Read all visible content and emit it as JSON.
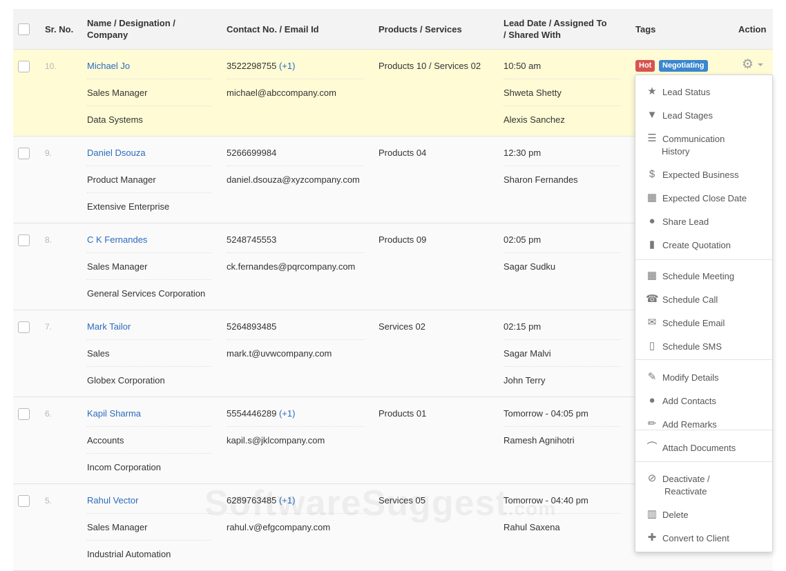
{
  "columns": {
    "srno": "Sr. No.",
    "name": [
      "Name / Designation /",
      "Company"
    ],
    "contact": "Contact No. / Email Id",
    "products": "Products / Services",
    "lead": [
      "Lead Date / Assigned To",
      "/ Shared With"
    ],
    "tags": "Tags",
    "action": "Action"
  },
  "leads": [
    {
      "sr": "10.",
      "name": "Michael Jo",
      "designation": "Sales Manager",
      "company": "Data Systems",
      "phone": "3522298755",
      "phone_ext": "(+1)",
      "email": "michael@abccompany.com",
      "products": "Products 10 / Services 02",
      "lead_date": "10:50 am",
      "assigned": "Shweta Shetty",
      "shared": "Alexis Sanchez"
    },
    {
      "sr": "9.",
      "name": "Daniel Dsouza",
      "designation": "Product Manager",
      "company": "Extensive Enterprise",
      "phone": "5266699984",
      "phone_ext": "",
      "email": "daniel.dsouza@xyzcompany.com",
      "products": "Products 04",
      "lead_date": "12:30 pm",
      "assigned": "Sharon Fernandes",
      "shared": ""
    },
    {
      "sr": "8.",
      "name": "C K Fernandes",
      "designation": "Sales Manager",
      "company": "General Services Corporation",
      "phone": "5248745553",
      "phone_ext": "",
      "email": "ck.fernandes@pqrcompany.com",
      "products": "Products 09",
      "lead_date": "02:05 pm",
      "assigned": "Sagar Sudku",
      "shared": ""
    },
    {
      "sr": "7.",
      "name": "Mark Tailor",
      "designation": "Sales",
      "company": "Globex Corporation",
      "phone": "5264893485",
      "phone_ext": "",
      "email": "mark.t@uvwcompany.com",
      "products": "Services 02",
      "lead_date": "02:15 pm",
      "assigned": "Sagar Malvi",
      "shared": "John Terry"
    },
    {
      "sr": "6.",
      "name": "Kapil Sharma",
      "designation": "Accounts",
      "company": "Incom Corporation",
      "phone": "5554446289",
      "phone_ext": "(+1)",
      "email": "kapil.s@jklcompany.com",
      "products": "Products 01",
      "lead_date": "Tomorrow - 04:05 pm",
      "assigned": "Ramesh Agnihotri",
      "shared": ""
    },
    {
      "sr": "5.",
      "name": "Rahul Vector",
      "designation": "Sales Manager",
      "company": "Industrial Automation",
      "phone": "6289763485",
      "phone_ext": "(+1)",
      "email": "rahul.v@efgcompany.com",
      "products": "Services 05",
      "lead_date": "Tomorrow - 04:40 pm",
      "assigned": "Rahul Saxena",
      "shared": ""
    }
  ],
  "tags": {
    "hot": "Hot",
    "negotiating": "Negotiating"
  },
  "tag_colors": {
    "hot": "#d9534f",
    "negotiating": "#3a87ce"
  },
  "highlight_color": "#fefbd5",
  "link_color": "#2a6bbf",
  "action_icon": "gear-icon",
  "menu": [
    {
      "icon": "star-icon",
      "label": "Lead Status"
    },
    {
      "icon": "filter-icon",
      "label": "Lead Stages"
    },
    {
      "icon": "list-icon",
      "label": "Communication",
      "label2": "History"
    },
    {
      "icon": "dollar-icon",
      "label": "Expected Business"
    },
    {
      "icon": "calendar-icon",
      "label": "Expected Close Date"
    },
    {
      "icon": "user-icon",
      "label": "Share Lead"
    },
    {
      "icon": "file-icon",
      "label": "Create Quotation"
    },
    {
      "icon": "calendar-icon",
      "label": "Schedule Meeting"
    },
    {
      "icon": "phone-icon",
      "label": "Schedule Call"
    },
    {
      "icon": "envelope-icon",
      "label": "Schedule Email"
    },
    {
      "icon": "mobile-icon",
      "label": "Schedule SMS"
    },
    {
      "icon": "edit-icon",
      "label": "Modify Details"
    },
    {
      "icon": "user-icon",
      "label": "Add Contacts"
    },
    {
      "icon": "pencil-icon",
      "label": "Add Remarks"
    },
    {
      "icon": "paperclip-icon",
      "label": "Attach Documents"
    },
    {
      "icon": "ban-icon",
      "label": "Deactivate /",
      "label2": "Reactivate"
    },
    {
      "icon": "trash-icon",
      "label": "Delete"
    },
    {
      "icon": "plus-icon",
      "label": "Convert to Client"
    }
  ],
  "watermark": {
    "main": "SoftwareSuggest",
    "suffix": ".com"
  }
}
